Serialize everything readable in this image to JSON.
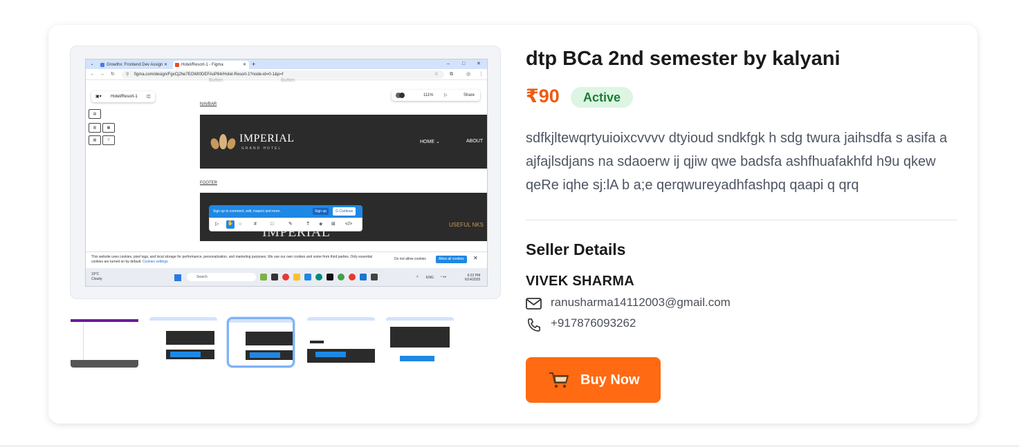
{
  "product": {
    "title": "dtp BCa 2nd semester by kalyani",
    "price": "₹90",
    "status": "Active",
    "description": "sdfkjltewqrtyuioixcvvvv dtyioud sndkfgk h sdg twura jaihsdfa s asifa a ajfajlsdjans na sdaoerw ij qjiw qwe badsfa ashfhuafakhfd h9u qkew qeRe iqhe sj:lA b a;e qerqwureyadhfashpq qaapi q qrq"
  },
  "seller": {
    "heading": "Seller Details",
    "name": "VIVEK SHARMA",
    "email": "ranusharma14112003@gmail.com",
    "phone": "+917876093262"
  },
  "actions": {
    "buy_label": "Buy Now"
  },
  "colors": {
    "accent": "#ff6a13",
    "price": "#f05a0e",
    "badge_bg": "#ddf5e3",
    "badge_text": "#1e7b35"
  },
  "gallery": {
    "selected_index": 2,
    "thumbnail_count": 5,
    "main_screenshot": {
      "tab1": "Growthx: Frontend Dev Assign",
      "tab2": "Hotel/Resort-1 - Figma",
      "url": "figma.com/design/FgxCj2he7EOWt0DEFAoP84/Hotel-Resort-1?node-id=0-1&p=f",
      "file_name": "Hotel/Resort-1",
      "zoom": "111%",
      "share": "Share",
      "ghost_button_1": "Button",
      "ghost_button_2": "Button",
      "navbar_label": "NAVBAR",
      "footer_label": "FOOTER",
      "brand": "IMPERIAL",
      "brand_sub": "GRAND HOTEL",
      "nav_home": "HOME",
      "nav_about": "ABOUT",
      "useful": "USEFUL",
      "useful_suffix": "NKS",
      "footer_brand": "IMPERIAL",
      "banner_text": "Sign up to comment, edit, inspect and more.",
      "banner_signup": "Sign up",
      "banner_continue": "Continue",
      "cookie_text": "This website uses cookies, pixel tags, and local storage for performance, personalization, and marketing purposes. We use our own cookies and some from third parties. Only essential cookies are turned on by default.",
      "cookie_link": "Cookies settings",
      "cookie_reject": "Do not allow cookies",
      "cookie_accept": "Allow all cookies",
      "weather_temp": "19°C",
      "weather_cond": "Cloudy",
      "search": "Search",
      "lang": "ENG",
      "time": "6:22 PM",
      "date": "6/14/2025"
    }
  }
}
